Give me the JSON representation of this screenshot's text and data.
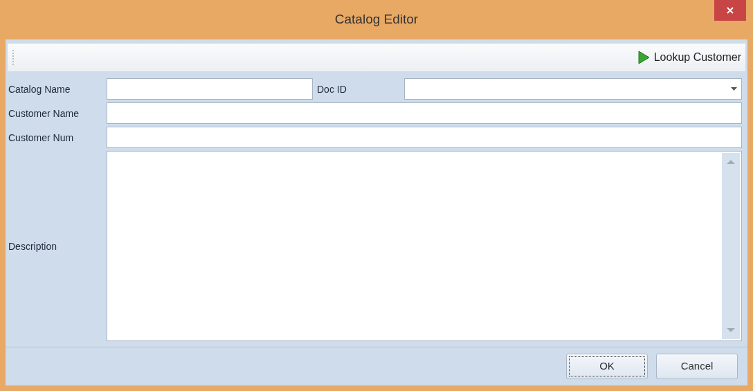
{
  "window": {
    "title": "Catalog Editor"
  },
  "toolbar": {
    "lookup_button": "Lookup Customer"
  },
  "form": {
    "catalog_name": {
      "label": "Catalog Name"
    },
    "doc_id": {
      "label": "Doc ID"
    },
    "customer_name": {
      "label": "Customer Name"
    },
    "customer_num": {
      "label": "Customer Num"
    },
    "description": {
      "label": "Description"
    }
  },
  "buttons": [
    {
      "label": "OK",
      "focused": true
    },
    {
      "label": "Cancel",
      "focused": false
    }
  ]
}
